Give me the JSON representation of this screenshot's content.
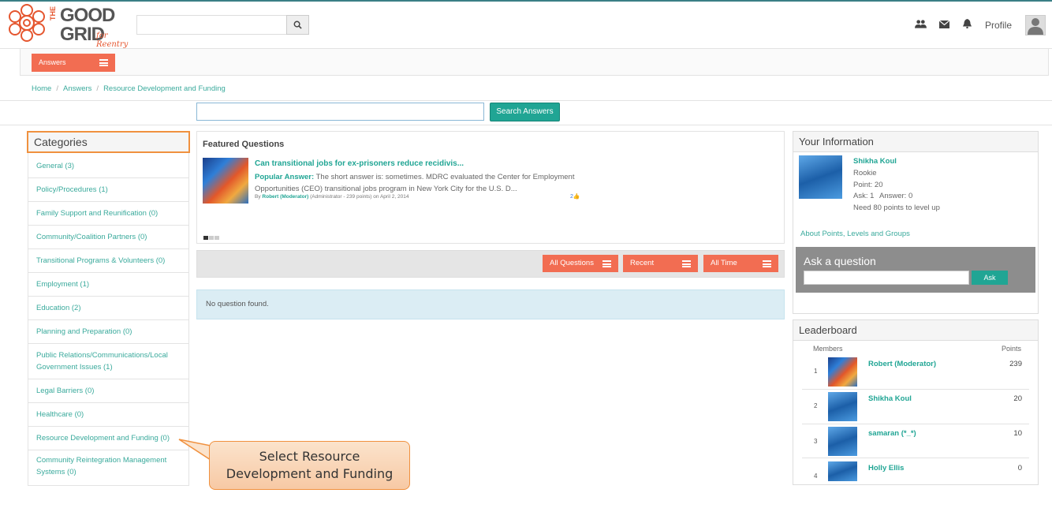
{
  "header": {
    "logo": {
      "the": "THE",
      "good": "GOOD",
      "grid": "GRID",
      "tagline": "for Reentry"
    },
    "search_placeholder": "",
    "profile_label": "Profile",
    "icons": [
      "users-icon",
      "mail-icon",
      "bell-icon",
      "search-icon",
      "user-avatar-icon"
    ]
  },
  "subnav": {
    "answers_label": "Answers"
  },
  "breadcrumb": [
    "Home",
    "Answers",
    "Resource Development and Funding"
  ],
  "answer_search": {
    "value": "",
    "button_label": "Search Answers"
  },
  "categories": {
    "title": "Categories",
    "items": [
      {
        "label": "General (3)"
      },
      {
        "label": "Policy/Procedures (1)"
      },
      {
        "label": "Family Support and Reunification (0)"
      },
      {
        "label": "Community/Coalition Partners (0)"
      },
      {
        "label": "Transitional Programs & Volunteers (0)"
      },
      {
        "label": "Employment (1)"
      },
      {
        "label": "Education (2)"
      },
      {
        "label": "Planning and Preparation (0)"
      },
      {
        "label": "Public Relations/Communications/Local Government Issues (1)"
      },
      {
        "label": "Legal Barriers (0)"
      },
      {
        "label": "Healthcare (0)"
      },
      {
        "label": "Resource Development and Funding (0)"
      },
      {
        "label": "Community Reintegration Management Systems (0)"
      }
    ]
  },
  "featured": {
    "title": "Featured Questions",
    "question": "Can transitional jobs for ex-prisoners reduce recidivis...",
    "popular_label": "Popular Answer:",
    "popular_text": " The short answer is: sometimes. MDRC evaluated the Center for Employment Opportunities (CEO) transitional jobs program in New York City for the U.S. D...",
    "by_prefix": "By ",
    "by_name": "Robert (Moderator)",
    "by_meta": "(Administrator - 239 points)  on April 2, 2014",
    "likes": "2"
  },
  "filters": {
    "all_questions": "All Questions",
    "recent": "Recent",
    "all_time": "All Time"
  },
  "no_question": "No question found.",
  "your_info": {
    "title": "Your Information",
    "name": "Shikha Koul",
    "rank": "Rookie",
    "points": "Point: 20",
    "ask": "Ask: 1",
    "answer": "Answer: 0",
    "level_up": "Need 80 points to level up",
    "link": "About Points, Levels and Groups"
  },
  "ask_question": {
    "title": "Ask a question",
    "button_label": "Ask"
  },
  "leaderboard": {
    "title": "Leaderboard",
    "col_members": "Members",
    "col_points": "Points",
    "rows": [
      {
        "rank": "1",
        "name": "Robert (Moderator)",
        "points": "239"
      },
      {
        "rank": "2",
        "name": "Shikha Koul",
        "points": "20"
      },
      {
        "rank": "3",
        "name": "samaran (*_*)",
        "points": "10"
      },
      {
        "rank": "4",
        "name": "Holly Ellis",
        "points": "0"
      }
    ]
  },
  "callout": {
    "line1": "Select Resource",
    "line2": "Development and Funding"
  },
  "colors": {
    "accent": "#f26d52",
    "teal": "#20a594",
    "callout_border": "#f0913f"
  }
}
